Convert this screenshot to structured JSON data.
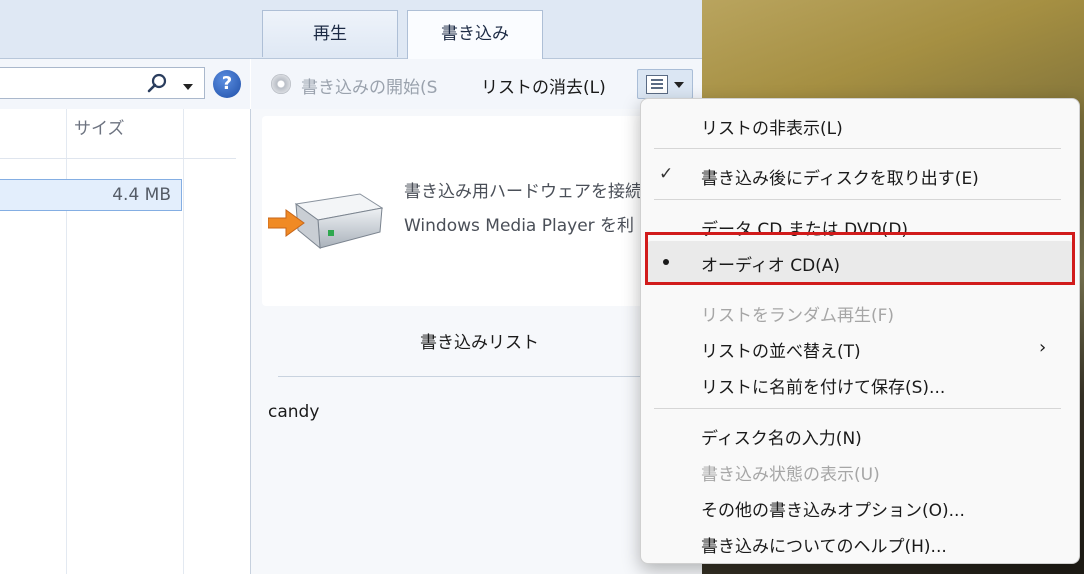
{
  "tabs": {
    "play": "再生",
    "burn": "書き込み"
  },
  "library": {
    "column_header": "サイズ",
    "selected_row_size": "4.4 MB"
  },
  "burn_toolbar": {
    "start_burn": "書き込みの開始(S",
    "clear_list": "リストの消去(L)"
  },
  "burn_pane": {
    "message_line1": "書き込み用ハードウェアを接続",
    "message_line2": "Windows Media Player を利",
    "list_title": "書き込みリスト",
    "items": [
      "candy"
    ]
  },
  "menu": {
    "hide_list": "リストの非表示(L)",
    "eject_after_burn": "書き込み後にディスクを取り出す(E)",
    "data_cd_dvd": "データ CD または DVD(D)",
    "audio_cd": "オーディオ CD(A)",
    "shuffle_list": "リストをランダム再生(F)",
    "sort_list": "リストの並べ替え(T)",
    "save_list_as": "リストに名前を付けて保存(S)...",
    "enter_disc_name": "ディスク名の入力(N)",
    "show_burn_status": "書き込み状態の表示(U)",
    "more_burn_options": "その他の書き込みオプション(O)...",
    "burn_help": "書き込みについてのヘルプ(H)..."
  },
  "icons": {
    "search": "search-icon",
    "help": "help-icon",
    "disc": "disc-icon",
    "list_options": "list-options-icon",
    "drive": "burner-drive-icon",
    "check": "checkmark-icon",
    "submenu": "chevron-right-icon"
  },
  "colors": {
    "highlight_outline": "#d11b1b",
    "selection_fill": "#e3eefc",
    "tabbar": "#dfe8f4"
  }
}
